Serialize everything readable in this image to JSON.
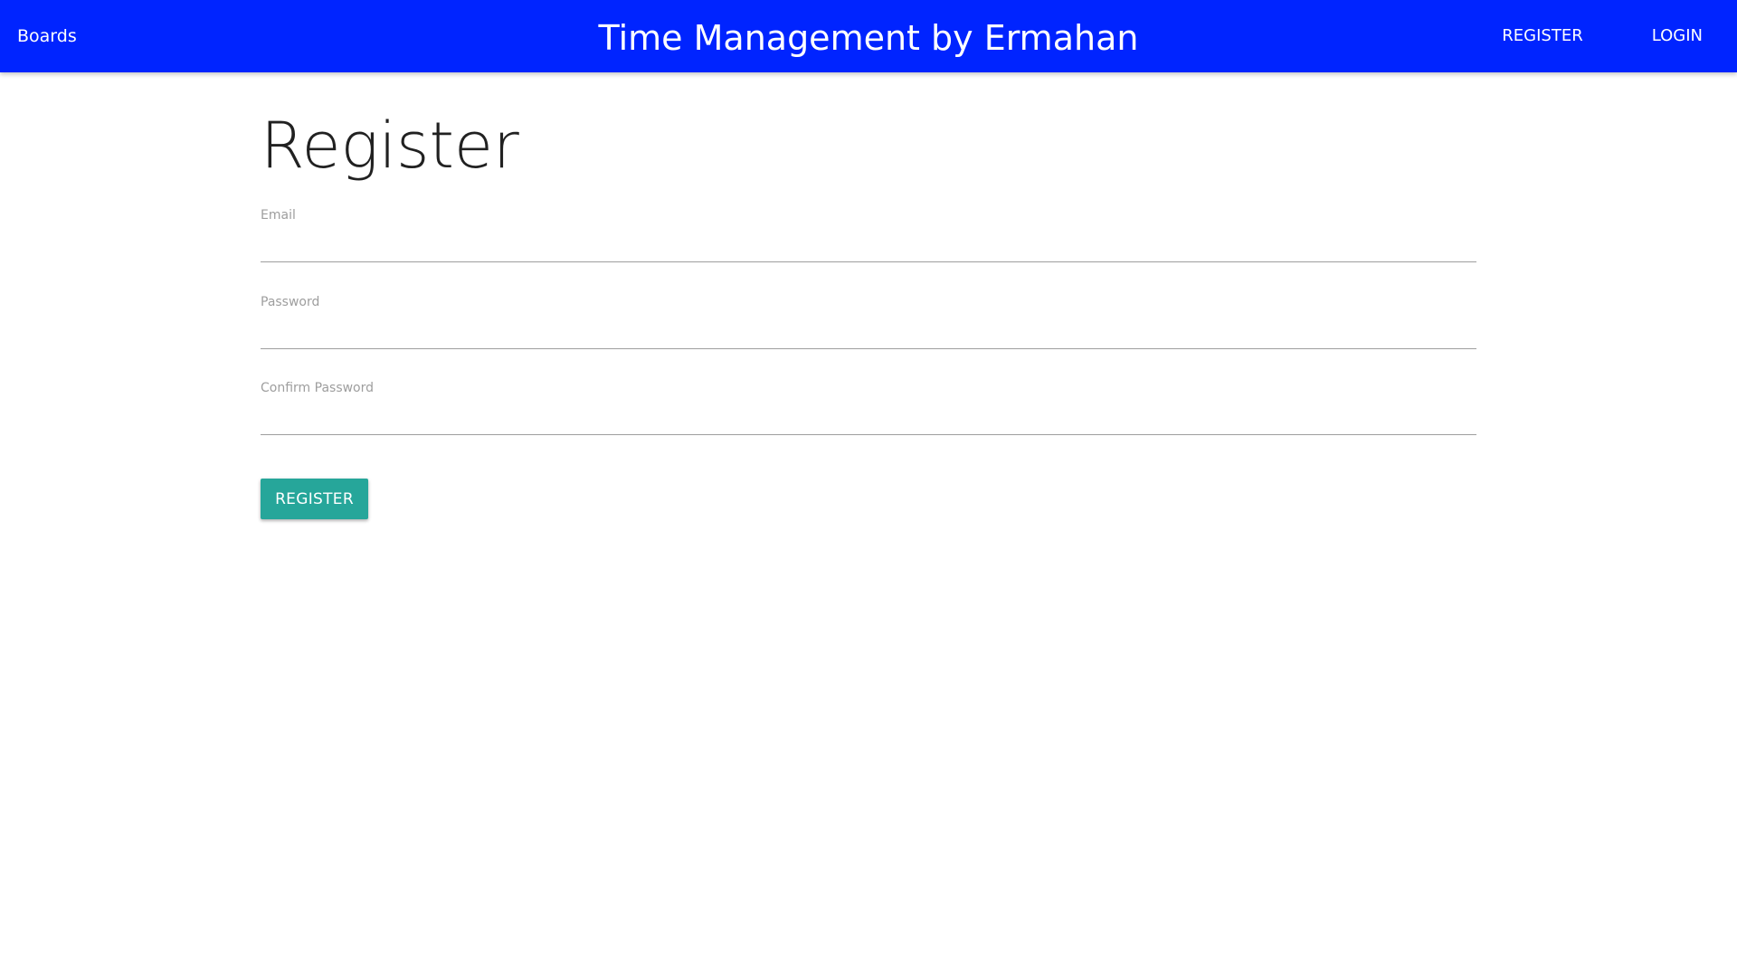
{
  "navbar": {
    "brand_link": "Boards",
    "title": "Time Management by Ermahan",
    "links": {
      "register": "REGISTER",
      "login": "LOGIN"
    },
    "background_color": "#0024ff"
  },
  "form": {
    "title": "Register",
    "fields": {
      "email": {
        "label": "Email",
        "value": ""
      },
      "password": {
        "label": "Password",
        "value": ""
      },
      "confirm_password": {
        "label": "Confirm Password",
        "value": ""
      }
    },
    "submit_label": "REGISTER",
    "submit_color": "#26a69a"
  }
}
